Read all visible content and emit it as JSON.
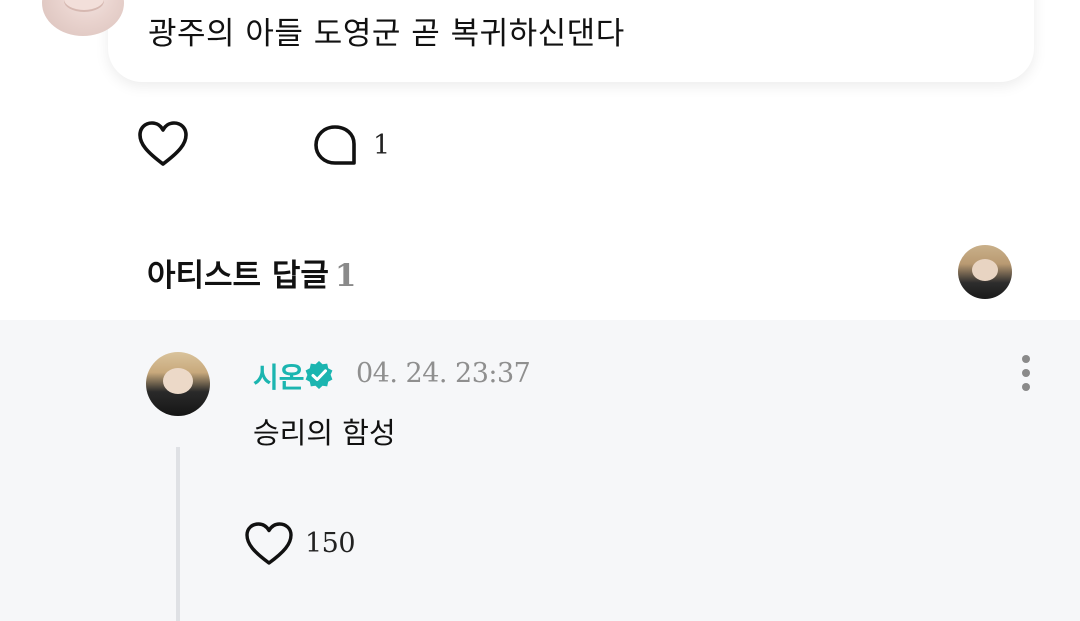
{
  "post": {
    "text": "광주의 아들 도영군 곧 복귀하신댄다",
    "comment_count": "1"
  },
  "artist_replies": {
    "title": "아티스트 답글",
    "count": "1"
  },
  "reply": {
    "author": "시온",
    "time": "04. 24. 23:37",
    "text": "승리의 함성",
    "like_count": "150"
  },
  "colors": {
    "accent": "#1bb5b0",
    "reply_bg": "#f6f7f9",
    "meta_gray": "#8f8f8f"
  },
  "icons": {
    "like": "heart-icon",
    "comment": "comment-bubble-icon",
    "verified": "verified-badge-icon",
    "more": "more-vertical-icon"
  }
}
